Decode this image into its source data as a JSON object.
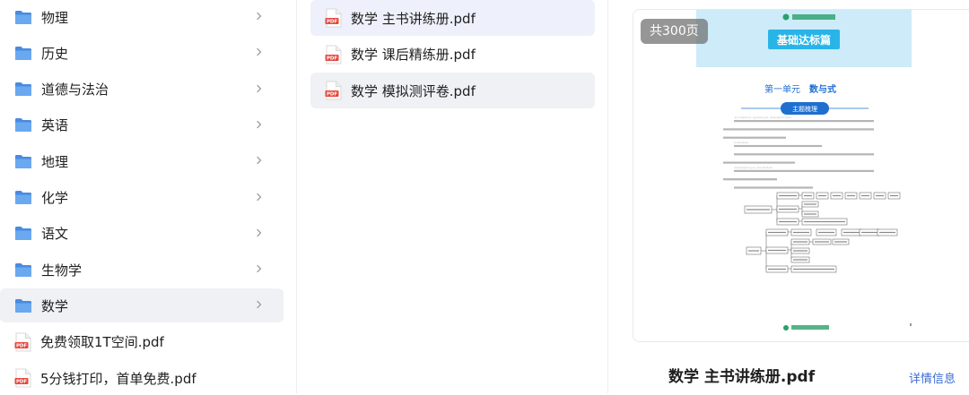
{
  "folders": [
    {
      "label": "物理",
      "type": "folder"
    },
    {
      "label": "历史",
      "type": "folder"
    },
    {
      "label": "道德与法治",
      "type": "folder"
    },
    {
      "label": "英语",
      "type": "folder"
    },
    {
      "label": "地理",
      "type": "folder"
    },
    {
      "label": "化学",
      "type": "folder"
    },
    {
      "label": "语文",
      "type": "folder"
    },
    {
      "label": "生物学",
      "type": "folder"
    },
    {
      "label": "数学",
      "type": "folder",
      "selected": true
    }
  ],
  "root_files": [
    {
      "label": "免费领取1T空间.pdf",
      "type": "pdf"
    },
    {
      "label": "5分钱打印，首单免费.pdf",
      "type": "pdf"
    }
  ],
  "files": [
    {
      "label": "数学 主书讲练册.pdf",
      "type": "pdf",
      "state": "active"
    },
    {
      "label": "数学 课后精练册.pdf",
      "type": "pdf"
    },
    {
      "label": "数学 模拟测评卷.pdf",
      "type": "pdf",
      "state": "hover"
    }
  ],
  "preview": {
    "page_count": "共300页",
    "title": "数学 主书讲练册.pdf",
    "detail_label": "详情信息",
    "doc": {
      "banner": "基础达标篇",
      "unit": "第一单元",
      "unit_topic": "数与式",
      "section_tag": "主题梳理",
      "paragraphs": [
        "“数与式”是代数的基本语言，也是初中数学的重要内容。代数式是对数量关系的一般性表达。",
        "数与代数式的研究路径。",
        "代数式是研究数量关系的重要工具，本单元从数到式逐步展开。"
      ]
    }
  },
  "colors": {
    "folder": "#5b9ae8",
    "pdf": "#e5483f",
    "selected_bg": "#f0f1f4",
    "active_bg": "#eef1fb",
    "link": "#3b6bd6",
    "doc_accent": "#1e6fd0",
    "doc_banner": "#29b4e8"
  },
  "icons": {
    "folder": "folder-icon",
    "pdf": "pdf-icon",
    "chevron": "chevron-right-icon"
  }
}
